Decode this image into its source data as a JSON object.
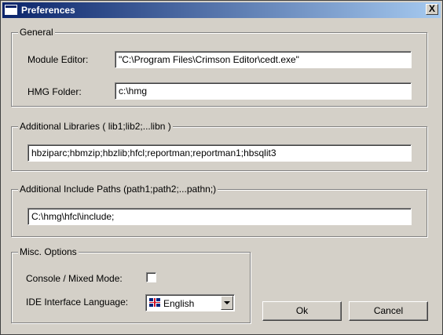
{
  "window": {
    "title": "Preferences",
    "close_label": "X"
  },
  "general": {
    "legend": "General",
    "module_editor_label": "Module Editor:",
    "module_editor_value": "\"C:\\Program Files\\Crimson Editor\\cedt.exe\"",
    "hmg_folder_label": "HMG Folder:",
    "hmg_folder_value": "c:\\hmg"
  },
  "libraries": {
    "legend": "Additional Libraries ( lib1;lib2;...libn )",
    "value": "hbziparc;hbmzip;hbzlib;hfcl;reportman;reportman1;hbsqlit3"
  },
  "include_paths": {
    "legend": "Additional Include Paths (path1;path2;...pathn;)",
    "value": "C:\\hmg\\hfcl\\include;"
  },
  "misc": {
    "legend": "Misc. Options",
    "console_label": "Console / Mixed Mode:",
    "console_checked": false,
    "language_label": "IDE Interface Language:",
    "language_value": "English",
    "language_flag_icon": "uk-flag-icon"
  },
  "buttons": {
    "ok": "Ok",
    "cancel": "Cancel"
  }
}
